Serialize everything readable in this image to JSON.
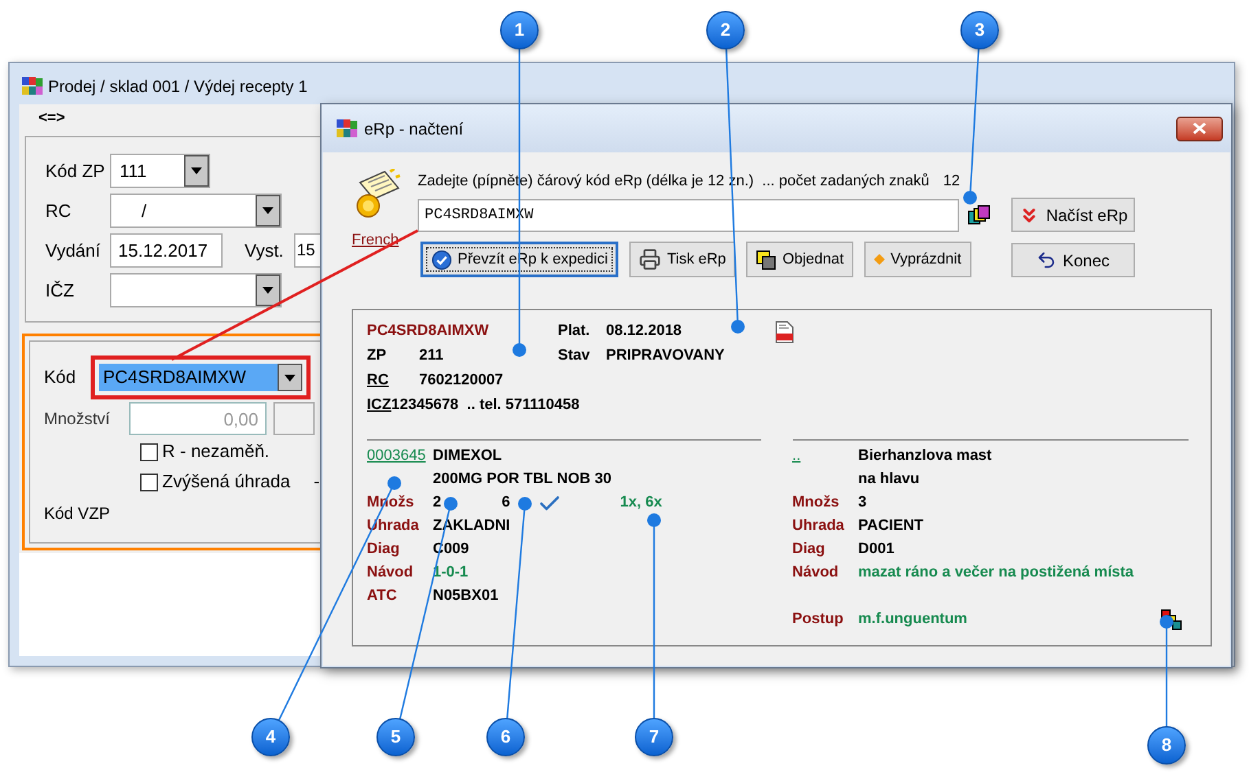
{
  "back_window": {
    "title": "Prodej / sklad 001 / Výdej recepty 1",
    "toolbar_label": "<=>",
    "kod_zp": {
      "label": "Kód ZP",
      "value": "111"
    },
    "rc": {
      "label": "RC",
      "value": "/"
    },
    "vydani": {
      "label": "Vydání",
      "value": "15.12.2017"
    },
    "vyst": {
      "label": "Vyst.",
      "value": "15"
    },
    "icz": {
      "label": "IČZ"
    },
    "kod": {
      "label": "Kód",
      "value": "PC4SRD8AIMXW",
      "selected": true
    },
    "mnozstvi": {
      "label": "Množství",
      "placeholder": "0,00"
    },
    "checkboxes": [
      {
        "label": "R - nezaměň.",
        "checked": false
      },
      {
        "label": "Zvýšená úhrada",
        "checked": false
      }
    ],
    "cut_text": "-",
    "kod_vzp": {
      "label": "Kód VZP"
    }
  },
  "dialog": {
    "title": "eRp - načtení",
    "prompt": "Zadejte (pípněte) čárový kód eRp (délka je 12 zn.)  ... počet zadaných znaků",
    "count": "12",
    "barcode": "PC4SRD8AIMXW",
    "link": "French",
    "buttons": [
      {
        "label": "Převzít eRp k expedici",
        "kind": "accept",
        "selected": true
      },
      {
        "label": "Tisk eRp",
        "kind": "print",
        "selected": false
      },
      {
        "label": "Objednat",
        "kind": "order",
        "selected": false
      },
      {
        "label": "Vyprázdnit",
        "kind": "clear",
        "selected": false
      }
    ],
    "side_buttons": [
      {
        "label": "Načíst eRp",
        "kind": "load"
      },
      {
        "label": "Konec",
        "kind": "exit"
      }
    ],
    "summary": {
      "code": "PC4SRD8AIMXW",
      "rows": [
        {
          "label": "ZP",
          "value": "211",
          "underlined": false
        },
        {
          "label": "RC",
          "value": "7602120007",
          "underlined": true
        },
        {
          "label": "ICZ",
          "value": "12345678  .. tel. 571110458",
          "underlined": true
        }
      ],
      "right_rows": [
        {
          "label": "Plat.",
          "value": "08.12.2018"
        },
        {
          "label": "Stav",
          "value": "PRIPRAVOVANY"
        }
      ]
    },
    "items": [
      {
        "code": "0003645",
        "name": "DIMEXOL",
        "detail": "200MG POR TBL NOB 30",
        "pieces": "6",
        "verified": true,
        "frequency": "1x, 6x",
        "rows": [
          {
            "label": "Množs",
            "value": "2",
            "kind": "plain"
          },
          {
            "label": "Uhrada",
            "value": "ZAKLADNI",
            "kind": "plain"
          },
          {
            "label": "Diag",
            "value": "C009",
            "kind": "plain"
          },
          {
            "label": "Návod",
            "value": "1-0-1",
            "kind": "instruction"
          },
          {
            "label": "ATC",
            "value": "N05BX01",
            "kind": "plain"
          }
        ]
      },
      {
        "code": "..",
        "name": "Bierhanzlova mast",
        "detail": "na hlavu",
        "verified": false,
        "rows": [
          {
            "label": "Množs",
            "value": "3",
            "kind": "plain"
          },
          {
            "label": "Uhrada",
            "value": "PACIENT",
            "kind": "plain"
          },
          {
            "label": "Diag",
            "value": "D001",
            "kind": "plain"
          },
          {
            "label": "Návod",
            "value": "mazat ráno a večer na postižená místa",
            "kind": "instruction"
          }
        ],
        "extra_rows": [
          {
            "label": "Postup",
            "value": "m.f.unguentum",
            "kind": "instruction"
          }
        ]
      }
    ]
  },
  "callouts": [
    {
      "number": "1"
    },
    {
      "number": "2"
    },
    {
      "number": "3"
    },
    {
      "number": "4"
    },
    {
      "number": "5"
    },
    {
      "number": "6"
    },
    {
      "number": "7"
    },
    {
      "number": "8"
    }
  ]
}
